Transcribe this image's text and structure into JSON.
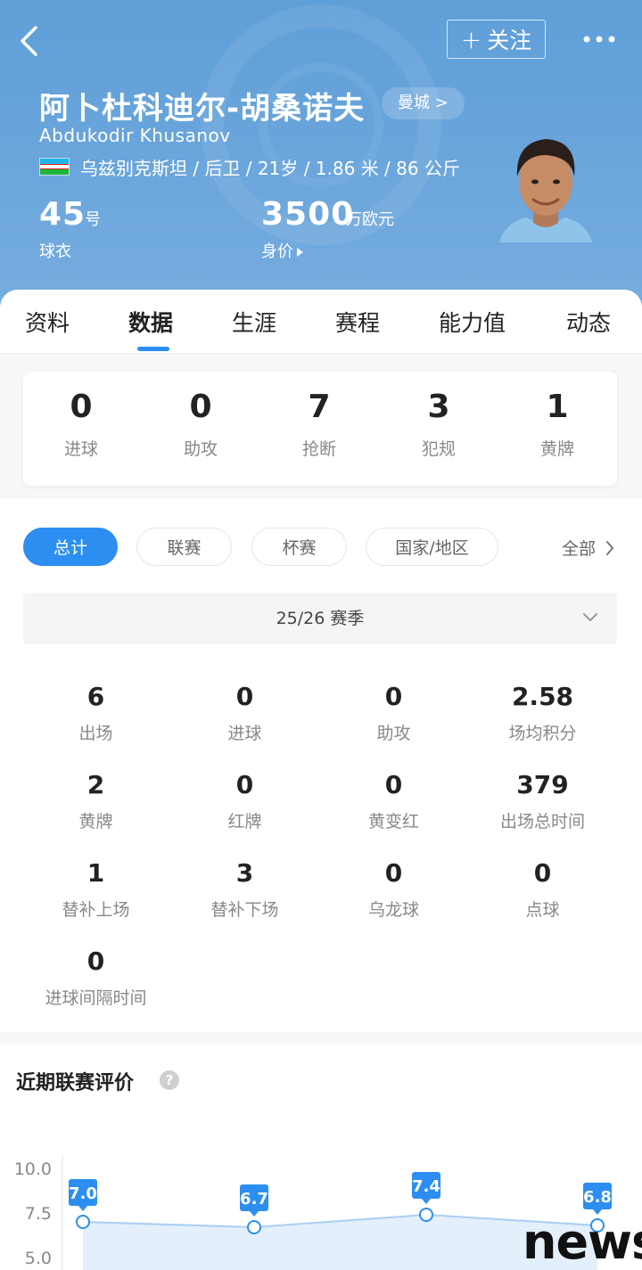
{
  "header": {
    "follow_label": "关注",
    "name_cn": "阿卜杜科迪尔-胡桑诺夫",
    "club": "曼城 >",
    "name_en": "Abdukodir Khusanov",
    "bio": "乌兹别克斯坦 / 后卫 / 21岁 / 1.86 米 / 86 公斤",
    "shirt_number": "45",
    "shirt_unit": "号",
    "shirt_label": "球衣",
    "value": "3500",
    "value_unit": "万欧元",
    "value_label": "身价",
    "bg_color": "#6ca6dc"
  },
  "tabs": [
    {
      "label": "资料"
    },
    {
      "label": "数据"
    },
    {
      "label": "生涯"
    },
    {
      "label": "赛程"
    },
    {
      "label": "能力值"
    },
    {
      "label": "动态"
    }
  ],
  "active_tab": "数据",
  "summary": [
    {
      "value": "0",
      "label": "进球"
    },
    {
      "value": "0",
      "label": "助攻"
    },
    {
      "value": "7",
      "label": "抢断"
    },
    {
      "value": "3",
      "label": "犯规"
    },
    {
      "value": "1",
      "label": "黄牌"
    }
  ],
  "filters": [
    {
      "label": "总计"
    },
    {
      "label": "联赛"
    },
    {
      "label": "杯赛"
    },
    {
      "label": "国家/地区"
    }
  ],
  "filter_all": "全部",
  "season": "25/26 赛季",
  "stats": [
    {
      "value": "6",
      "label": "出场"
    },
    {
      "value": "0",
      "label": "进球"
    },
    {
      "value": "0",
      "label": "助攻"
    },
    {
      "value": "2.58",
      "label": "场均积分"
    },
    {
      "value": "2",
      "label": "黄牌"
    },
    {
      "value": "0",
      "label": "红牌"
    },
    {
      "value": "0",
      "label": "黄变红"
    },
    {
      "value": "379",
      "label": "出场总时间"
    },
    {
      "value": "1",
      "label": "替补上场"
    },
    {
      "value": "3",
      "label": "替补下场"
    },
    {
      "value": "0",
      "label": "乌龙球"
    },
    {
      "value": "0",
      "label": "点球"
    },
    {
      "value": "0",
      "label": "进球间隔时间"
    }
  ],
  "section_title": "近期联赛评价",
  "help_symbol": "?",
  "chart_data": {
    "type": "line",
    "y_ticks": [
      "10.0",
      "7.5",
      "5.0"
    ],
    "ylim": [
      5.0,
      10.0
    ],
    "values": [
      7.0,
      6.7,
      7.4,
      6.8
    ],
    "labels": [
      "7.0",
      "6.7",
      "7.4",
      "6.8"
    ],
    "color": "#2c8ef0"
  },
  "watermark": "news"
}
